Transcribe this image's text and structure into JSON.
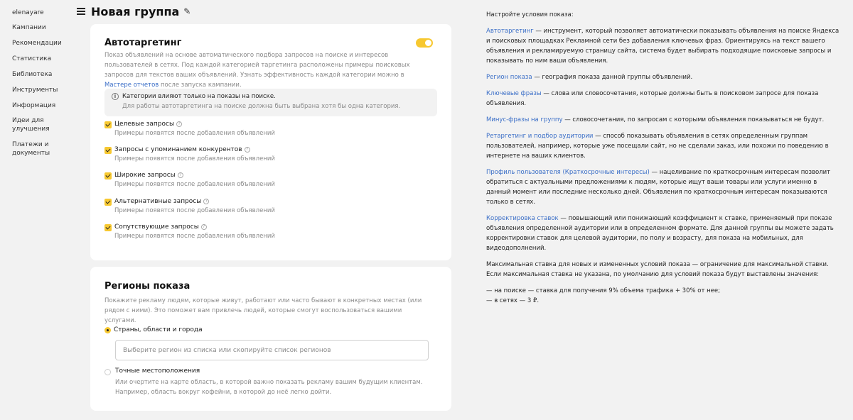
{
  "sidebar": {
    "user": "elenayare",
    "items": [
      {
        "label": "Кампании"
      },
      {
        "label": "Рекомендации"
      },
      {
        "label": "Статистика"
      },
      {
        "label": "Библиотека"
      },
      {
        "label": "Инструменты"
      },
      {
        "label": "Информация"
      },
      {
        "label": "Идеи для улучшения"
      },
      {
        "label": "Платежи и документы"
      }
    ]
  },
  "header": {
    "title": "Новая группа",
    "edit_icon": "pencil-icon",
    "menu_icon": "list-menu-icon"
  },
  "autotargeting": {
    "title": "Автотаргетинг",
    "enabled": true,
    "desc_part1": "Показ объявлений на основе автоматического подбора запросов на поиске и интересов пользователей в сетях. Под каждой категорией таргетинга расположены примеры поисковых запросов для текстов ваших объявлений. Узнать эффективность каждой категории можно в ",
    "desc_link": "Мастере отчетов",
    "desc_part2": " после запуска кампании.",
    "info_title": "Категории влияют только на показы на поиске.",
    "info_text": "Для работы автотаргетинга на поиске должна быть выбрана хотя бы одна категория.",
    "categories": [
      {
        "label": "Целевые запросы",
        "hint": "Примеры появятся после добавления объявлений",
        "checked": true
      },
      {
        "label": "Запросы с упоминанием конкурентов",
        "hint": "Примеры появятся после добавления объявлений",
        "checked": true
      },
      {
        "label": "Широкие запросы",
        "hint": "Примеры появятся после добавления объявлений",
        "checked": true
      },
      {
        "label": "Альтернативные запросы",
        "hint": "Примеры появятся после добавления объявлений",
        "checked": true
      },
      {
        "label": "Сопутствующие запросы",
        "hint": "Примеры появятся после добавления объявлений",
        "checked": true
      }
    ]
  },
  "regions": {
    "title": "Регионы показа",
    "desc": "Покажите рекламу людям, которые живут, работают или часто бывают в конкретных местах (или рядом с ними). Это поможет вам привлечь людей, которые смогут воспользоваться вашими услугами.",
    "option_countries": "Страны, области и города",
    "input_placeholder": "Выберите регион из списка или скопируйте список регионов",
    "option_exact": "Точные местоположения",
    "exact_desc": "Или очертите на карте область, в которой важно показать рекламу вашим будущим клиентам. Например, область вокруг кофейни, в которой до неё легко дойти."
  },
  "help": {
    "intro": "Настройте условия показа:",
    "items": [
      {
        "term": "Автотаргетинг",
        "text": " — инструмент, который позволяет автоматически показывать объявления на поиске Яндекса и поисковых площадках Рекламной сети без добавления ключевых фраз. Ориентируясь на текст вашего объявления и рекламируемую страницу сайта, система будет выбирать подходящие поисковые запросы и показывать по ним ваши объявления."
      },
      {
        "term": "Регион показа",
        "text": " — география показа данной группы объявлений."
      },
      {
        "term": "Ключевые фразы",
        "text": " — слова или словосочетания, которые должны быть в поисковом запросе для показа объявления."
      },
      {
        "term": "Минус-фразы на группу",
        "text": " — словосочетания, по запросам с которыми объявления показываться не будут."
      },
      {
        "term": "Ретаргетинг и подбор аудитории",
        "text": " — способ показывать объявления в сетях определенным группам пользователей, например, которые уже посещали сайт, но не сделали заказ, или похожи по поведению в интернете на ваших клиентов."
      },
      {
        "term": "Профиль пользователя (Краткосрочные интересы)",
        "text": " — нацеливание по краткосрочным интересам позволит обратиться с актуальными предложениями к людям, которые ищут ваши товары или услуги именно в данный момент или последние несколько дней. Объявления по краткосрочным интересам показываются только в сетях."
      },
      {
        "term": "Корректировка ставок",
        "text": " — повышающий или понижающий коэффициент к ставке, применяемый при показе объявления определенной аудитории или в определенном формате. Для данной группы вы можете задать корректировки ставок для целевой аудитории, по полу и возрасту, для показа на мобильных, для видеодополнений."
      }
    ],
    "max_bid": "Максимальная ставка для новых и измененных условий показа — ограничение для максимальной ставки. Если максимальная ставка не указана, по умолчанию для условий показа будут выставлены значения:",
    "search_line": "—   на поиске — ставка для получения 9% объема трафика + 30% от нее;",
    "network_line": "—   в сетях — 3 ₽."
  }
}
